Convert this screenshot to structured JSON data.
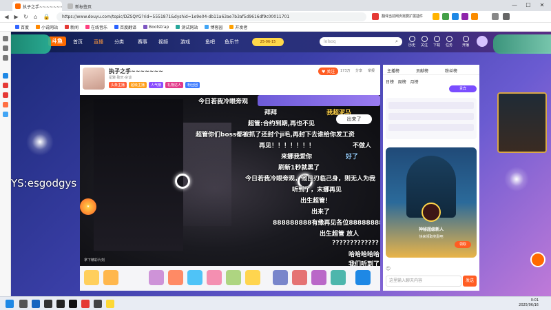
{
  "browser": {
    "tab_title": "执子之手~~~~~~~ 斗鱼直播",
    "new_tab_label": "新标签页",
    "url": "https://www.douyu.com/topic/DZSQYG?rid=5551871&dyshid=1e9e04-db11a63ae7b3af5d9616df9c00011701",
    "window_min": "—",
    "window_max": "☐",
    "window_close": "✕",
    "side_translate_label": "翻译当前网页需要扩展插件"
  },
  "bookmarks": [
    {
      "label": "百度",
      "color": "#3366ff"
    },
    {
      "label": "小说网站",
      "color": "#ff8800"
    },
    {
      "label": "新闻",
      "color": "#e53935"
    },
    {
      "label": "在线音乐",
      "color": "#ff4081"
    },
    {
      "label": "百度翻译",
      "color": "#2962ff"
    },
    {
      "label": "Bootstrap",
      "color": "#7e57c2"
    },
    {
      "label": "测试网站",
      "color": "#26a69a"
    },
    {
      "label": "博客园",
      "color": "#42a5f5"
    },
    {
      "label": "开发者",
      "color": "#ffa000"
    }
  ],
  "douyu": {
    "logo": "斗鱼",
    "nav": [
      "首页",
      "直播",
      "分类",
      "赛事",
      "视频",
      "游戏",
      "鱼吧",
      "鱼乐节"
    ],
    "search_placeholder": "lolsoq",
    "header_icons": [
      "历史",
      "关注",
      "下载",
      "任务",
      "开播"
    ],
    "event_badge": "25-06-15"
  },
  "room": {
    "streamer_name": "执子之手~~~~~~~",
    "streamer_level": "主播",
    "sub_info": "星聚·聊天·杂谈",
    "follow_label": "关注",
    "follow_count": "173万",
    "share_label": "分享",
    "report_label": "举报",
    "tags": [
      "头条主播",
      "超级主播",
      "人气榜",
      "礼物达人",
      "粉丝团"
    ]
  },
  "danmaku": [
    "今日若我冷眼旁观",
    "拜拜",
    "我超泥马",
    "出来了",
    "超管:合约到期,再也不见",
    "超管你们boss都被抓了还封个ji毛,再封下去谁给你发工资",
    "再见！！！！！！！",
    "不做人",
    "来娜我爱你",
    "好了",
    "刷新1秒就黑了",
    "今日若我冷眼旁观，他日刃临己身，则无人为我",
    "听到了，末娜再见",
    "出生超管！",
    "出来了",
    "888888888有缘再见各位888888888",
    "出生超管 放人",
    "?????????????",
    "哈哈哈哈哈",
    "我们听到了"
  ],
  "video_watermark": "拿下精彩片刻",
  "overlay_text": "YS:esgodgys",
  "side": {
    "tabs": [
      "主播榜",
      "贡献榜",
      "粉丝榜"
    ],
    "rank_title": "贵宾",
    "rows": [
      "日榜",
      "周榜",
      "月榜"
    ],
    "promo_title": "神秘超级新人",
    "promo_sub": "快来领取奖励吧",
    "promo_btn": "领取",
    "chat_placeholder": "这里输入聊天内容",
    "send_label": "发送"
  },
  "taskbar": {
    "time": "0:01",
    "date": "2025/06/16"
  }
}
